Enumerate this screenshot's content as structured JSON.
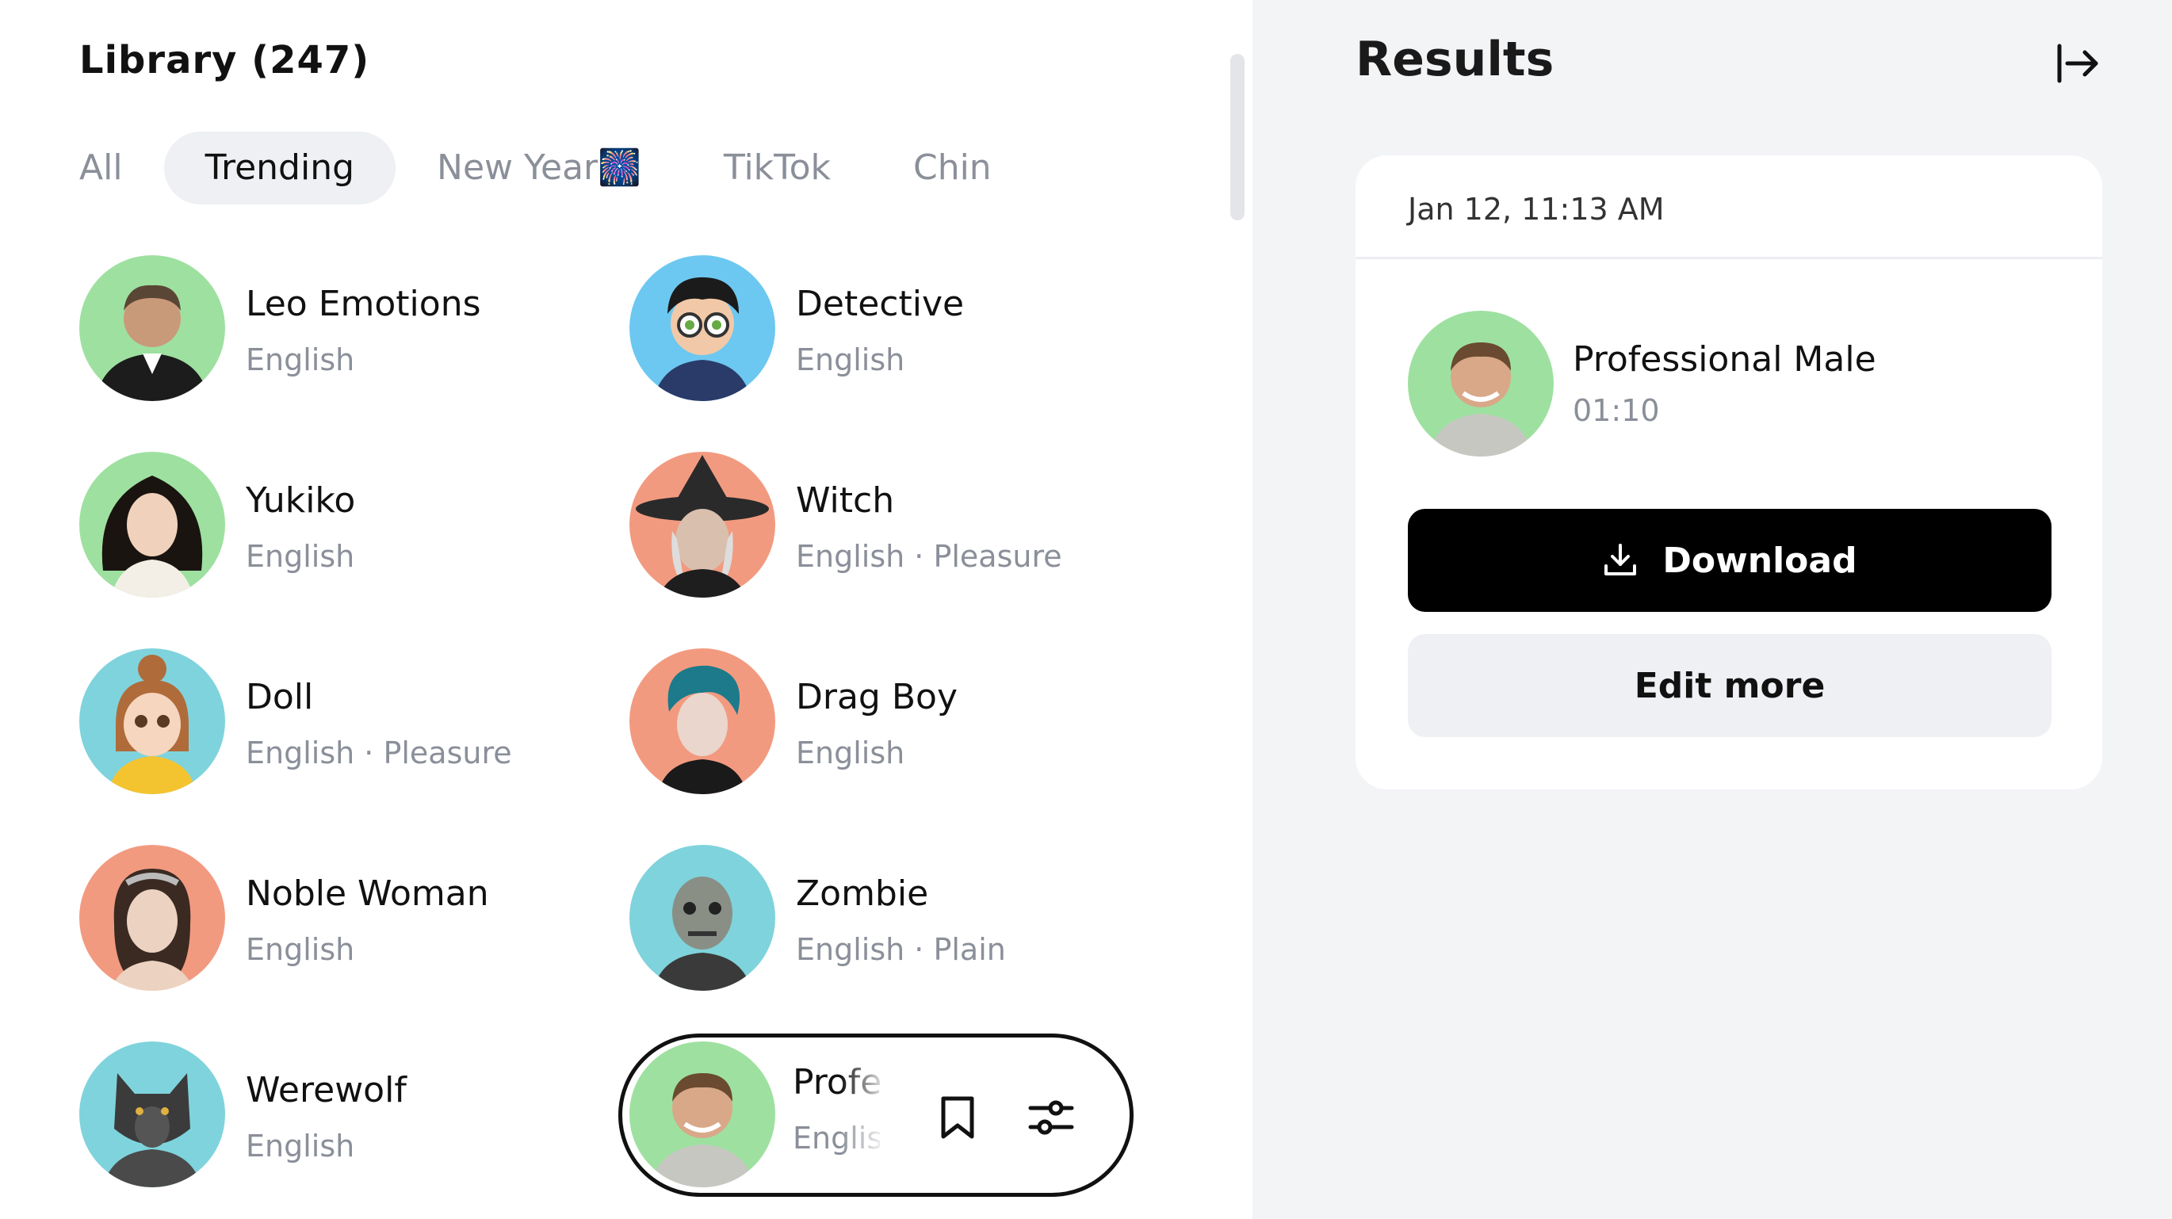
{
  "library": {
    "title": "Library (247)",
    "tabs": [
      {
        "label": "All",
        "active": false
      },
      {
        "label": "Trending",
        "active": true
      },
      {
        "label": "New Year🎆",
        "active": false
      },
      {
        "label": "TikTok",
        "active": false
      },
      {
        "label": "Chin",
        "active": false
      }
    ],
    "filter_icon": "filter-icon",
    "voices": [
      {
        "name": "Leo Emotions",
        "meta": "English",
        "bg": "#9ee0a0"
      },
      {
        "name": "Detective",
        "meta": "English",
        "bg": "#6cc8f0"
      },
      {
        "name": "Yukiko",
        "meta": "English",
        "bg": "#9ee0a0"
      },
      {
        "name": "Witch",
        "meta": "English · Pleasure",
        "bg": "#f29a80"
      },
      {
        "name": "Doll",
        "meta": "English · Pleasure",
        "bg": "#7fd3dc"
      },
      {
        "name": "Drag Boy",
        "meta": "English",
        "bg": "#f29a80"
      },
      {
        "name": "Noble Woman",
        "meta": "English",
        "bg": "#f29a80"
      },
      {
        "name": "Zombie",
        "meta": "English · Plain",
        "bg": "#7fd3dc"
      },
      {
        "name": "Werewolf",
        "meta": "English",
        "bg": "#7fd3dc"
      }
    ],
    "selected_voice": {
      "name": "Profe",
      "meta": "Englis",
      "bg": "#9ee0a0"
    },
    "bookmark_icon": "bookmark-icon",
    "settings_icon": "sliders-icon"
  },
  "results": {
    "title": "Results",
    "collapse_icon": "collapse-panel-icon",
    "item": {
      "date": "Jan 12, 11:13 AM",
      "name": "Professional Male",
      "duration": "01:10",
      "bg": "#9ee0a0"
    },
    "download_label": "Download",
    "edit_label": "Edit more"
  }
}
